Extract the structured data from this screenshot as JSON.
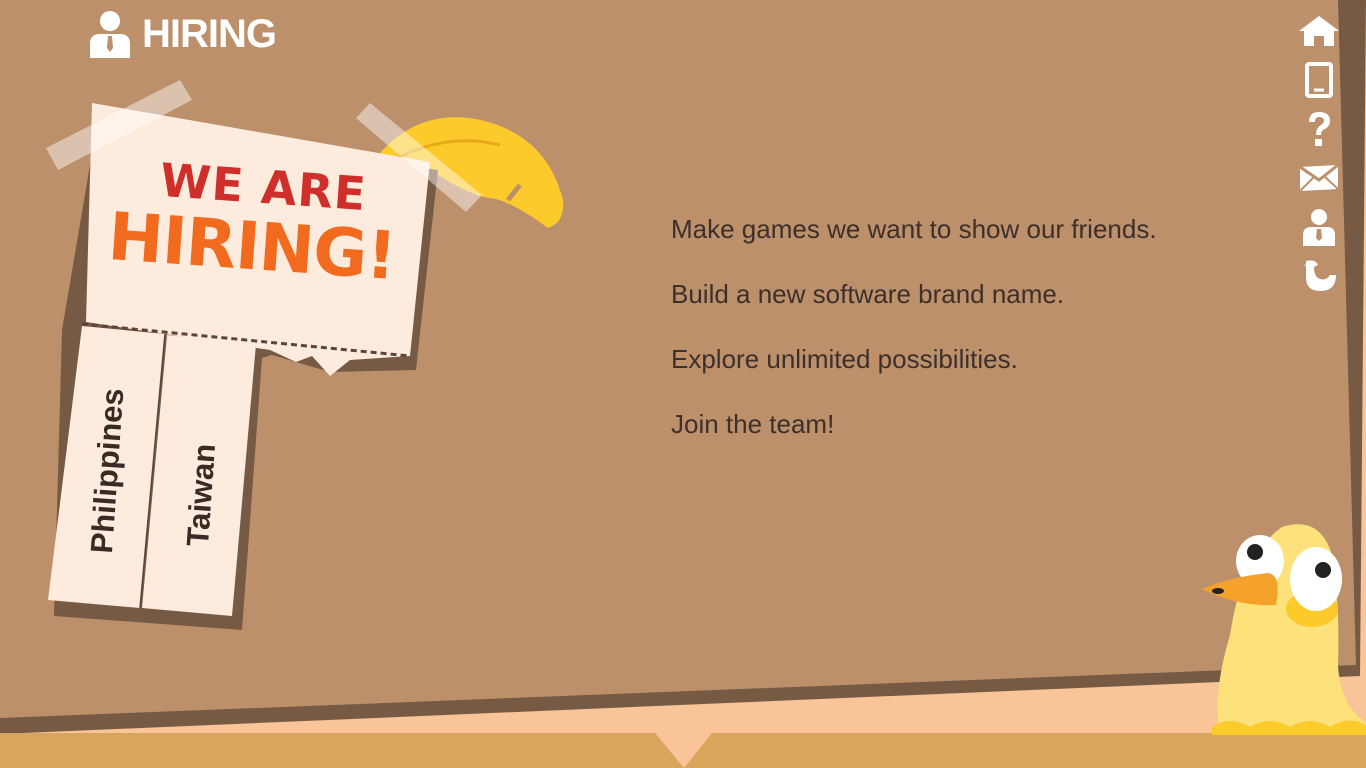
{
  "header": {
    "title": "HIRING",
    "icon": "person-with-tie-icon"
  },
  "nav": {
    "items": [
      {
        "icon": "home-icon"
      },
      {
        "icon": "tablet-icon"
      },
      {
        "icon": "question-icon"
      },
      {
        "icon": "mail-icon"
      },
      {
        "icon": "person-with-tie-icon"
      },
      {
        "icon": "bird-icon"
      }
    ]
  },
  "notice": {
    "headline_line1": "WE ARE",
    "headline_line2": "HIRING!",
    "tabs": [
      "Philippines",
      "Taiwan"
    ]
  },
  "main": {
    "lines": [
      "Make games we want to show our friends.",
      "Build a new software brand name.",
      "Explore unlimited possibilities.",
      "Join the team!"
    ]
  },
  "colors": {
    "board": "#bd906c",
    "board_shadow": "#775a44",
    "backdrop": "#f9c498",
    "bottom_bar": "#d8a55c",
    "headline_red": "#cf2f2a",
    "headline_orange": "#f26a1d",
    "paper": "#fdebdd",
    "feather": "#fccb2b",
    "text": "#3d2f29"
  }
}
